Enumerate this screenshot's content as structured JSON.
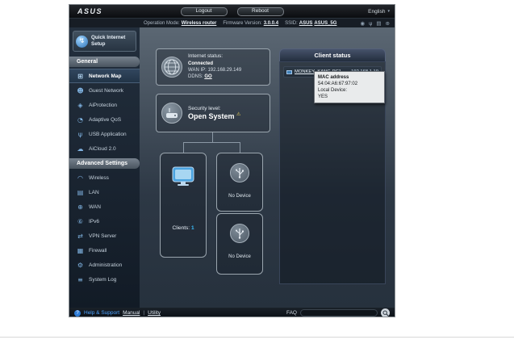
{
  "topbar": {
    "brand": "ASUS",
    "logout_label": "Logout",
    "reboot_label": "Reboot",
    "language_label": "English",
    "caret": "▾"
  },
  "infobar": {
    "operation_mode_label": "Operation Mode:",
    "operation_mode_value": "Wireless router",
    "firmware_label": "Firmware Version:",
    "firmware_value": "3.0.0.4",
    "ssid_label": "SSID:",
    "ssid_value_1": "ASUS",
    "ssid_value_2": "ASUS_5G",
    "status_icons": [
      {
        "glyph": "◉"
      },
      {
        "glyph": "ψ"
      },
      {
        "glyph": "▤"
      },
      {
        "glyph": "⊕"
      }
    ]
  },
  "sidebar": {
    "qis_label": "Quick Internet Setup",
    "qis_glyph": "↯",
    "general_header": "General",
    "advanced_header": "Advanced Settings",
    "general_items": [
      {
        "label": "Network Map",
        "glyph": "⊞"
      },
      {
        "label": "Guest Network",
        "glyph": "☻"
      },
      {
        "label": "AiProtection",
        "glyph": "◈"
      },
      {
        "label": "Adaptive QoS",
        "glyph": "◔"
      },
      {
        "label": "USB Application",
        "glyph": "ψ"
      },
      {
        "label": "AiCloud 2.0",
        "glyph": "☁"
      }
    ],
    "advanced_items": [
      {
        "label": "Wireless",
        "glyph": "◠"
      },
      {
        "label": "LAN",
        "glyph": "▤"
      },
      {
        "label": "WAN",
        "glyph": "⊕"
      },
      {
        "label": "IPv6",
        "glyph": "⑥"
      },
      {
        "label": "VPN Server",
        "glyph": "⇄"
      },
      {
        "label": "Firewall",
        "glyph": "▦"
      },
      {
        "label": "Administration",
        "glyph": "⚙"
      },
      {
        "label": "System Log",
        "glyph": "≡"
      }
    ]
  },
  "main": {
    "internet_status_label": "Internet status:",
    "internet_status_value": "Connected",
    "wan_ip_label": "WAN IP:",
    "wan_ip_value": "192.168.29.149",
    "ddns_label": "DDNS:",
    "ddns_link": "GO",
    "security_label": "Security level:",
    "security_value": "Open System",
    "security_warn_glyph": "⚠",
    "clients_label": "Clients:",
    "clients_count": "1",
    "usb_slot_1": "No Device",
    "usb_slot_2": "No Device"
  },
  "client_status": {
    "title": "Client status",
    "rows": [
      {
        "name": "MONKEY_KANG-PC1",
        "ip": "192.168.1.10"
      }
    ],
    "tooltip": {
      "mac_label": "MAC address",
      "mac_value": "54:04:A6:67:97:02",
      "local_label": "Local Device:",
      "local_value": "YES"
    }
  },
  "footer": {
    "help_glyph": "?",
    "help_label": "Help & Support",
    "manual_label": "Manual",
    "separator": "|",
    "utility_label": "Utility",
    "faq_label": "FAQ"
  }
}
